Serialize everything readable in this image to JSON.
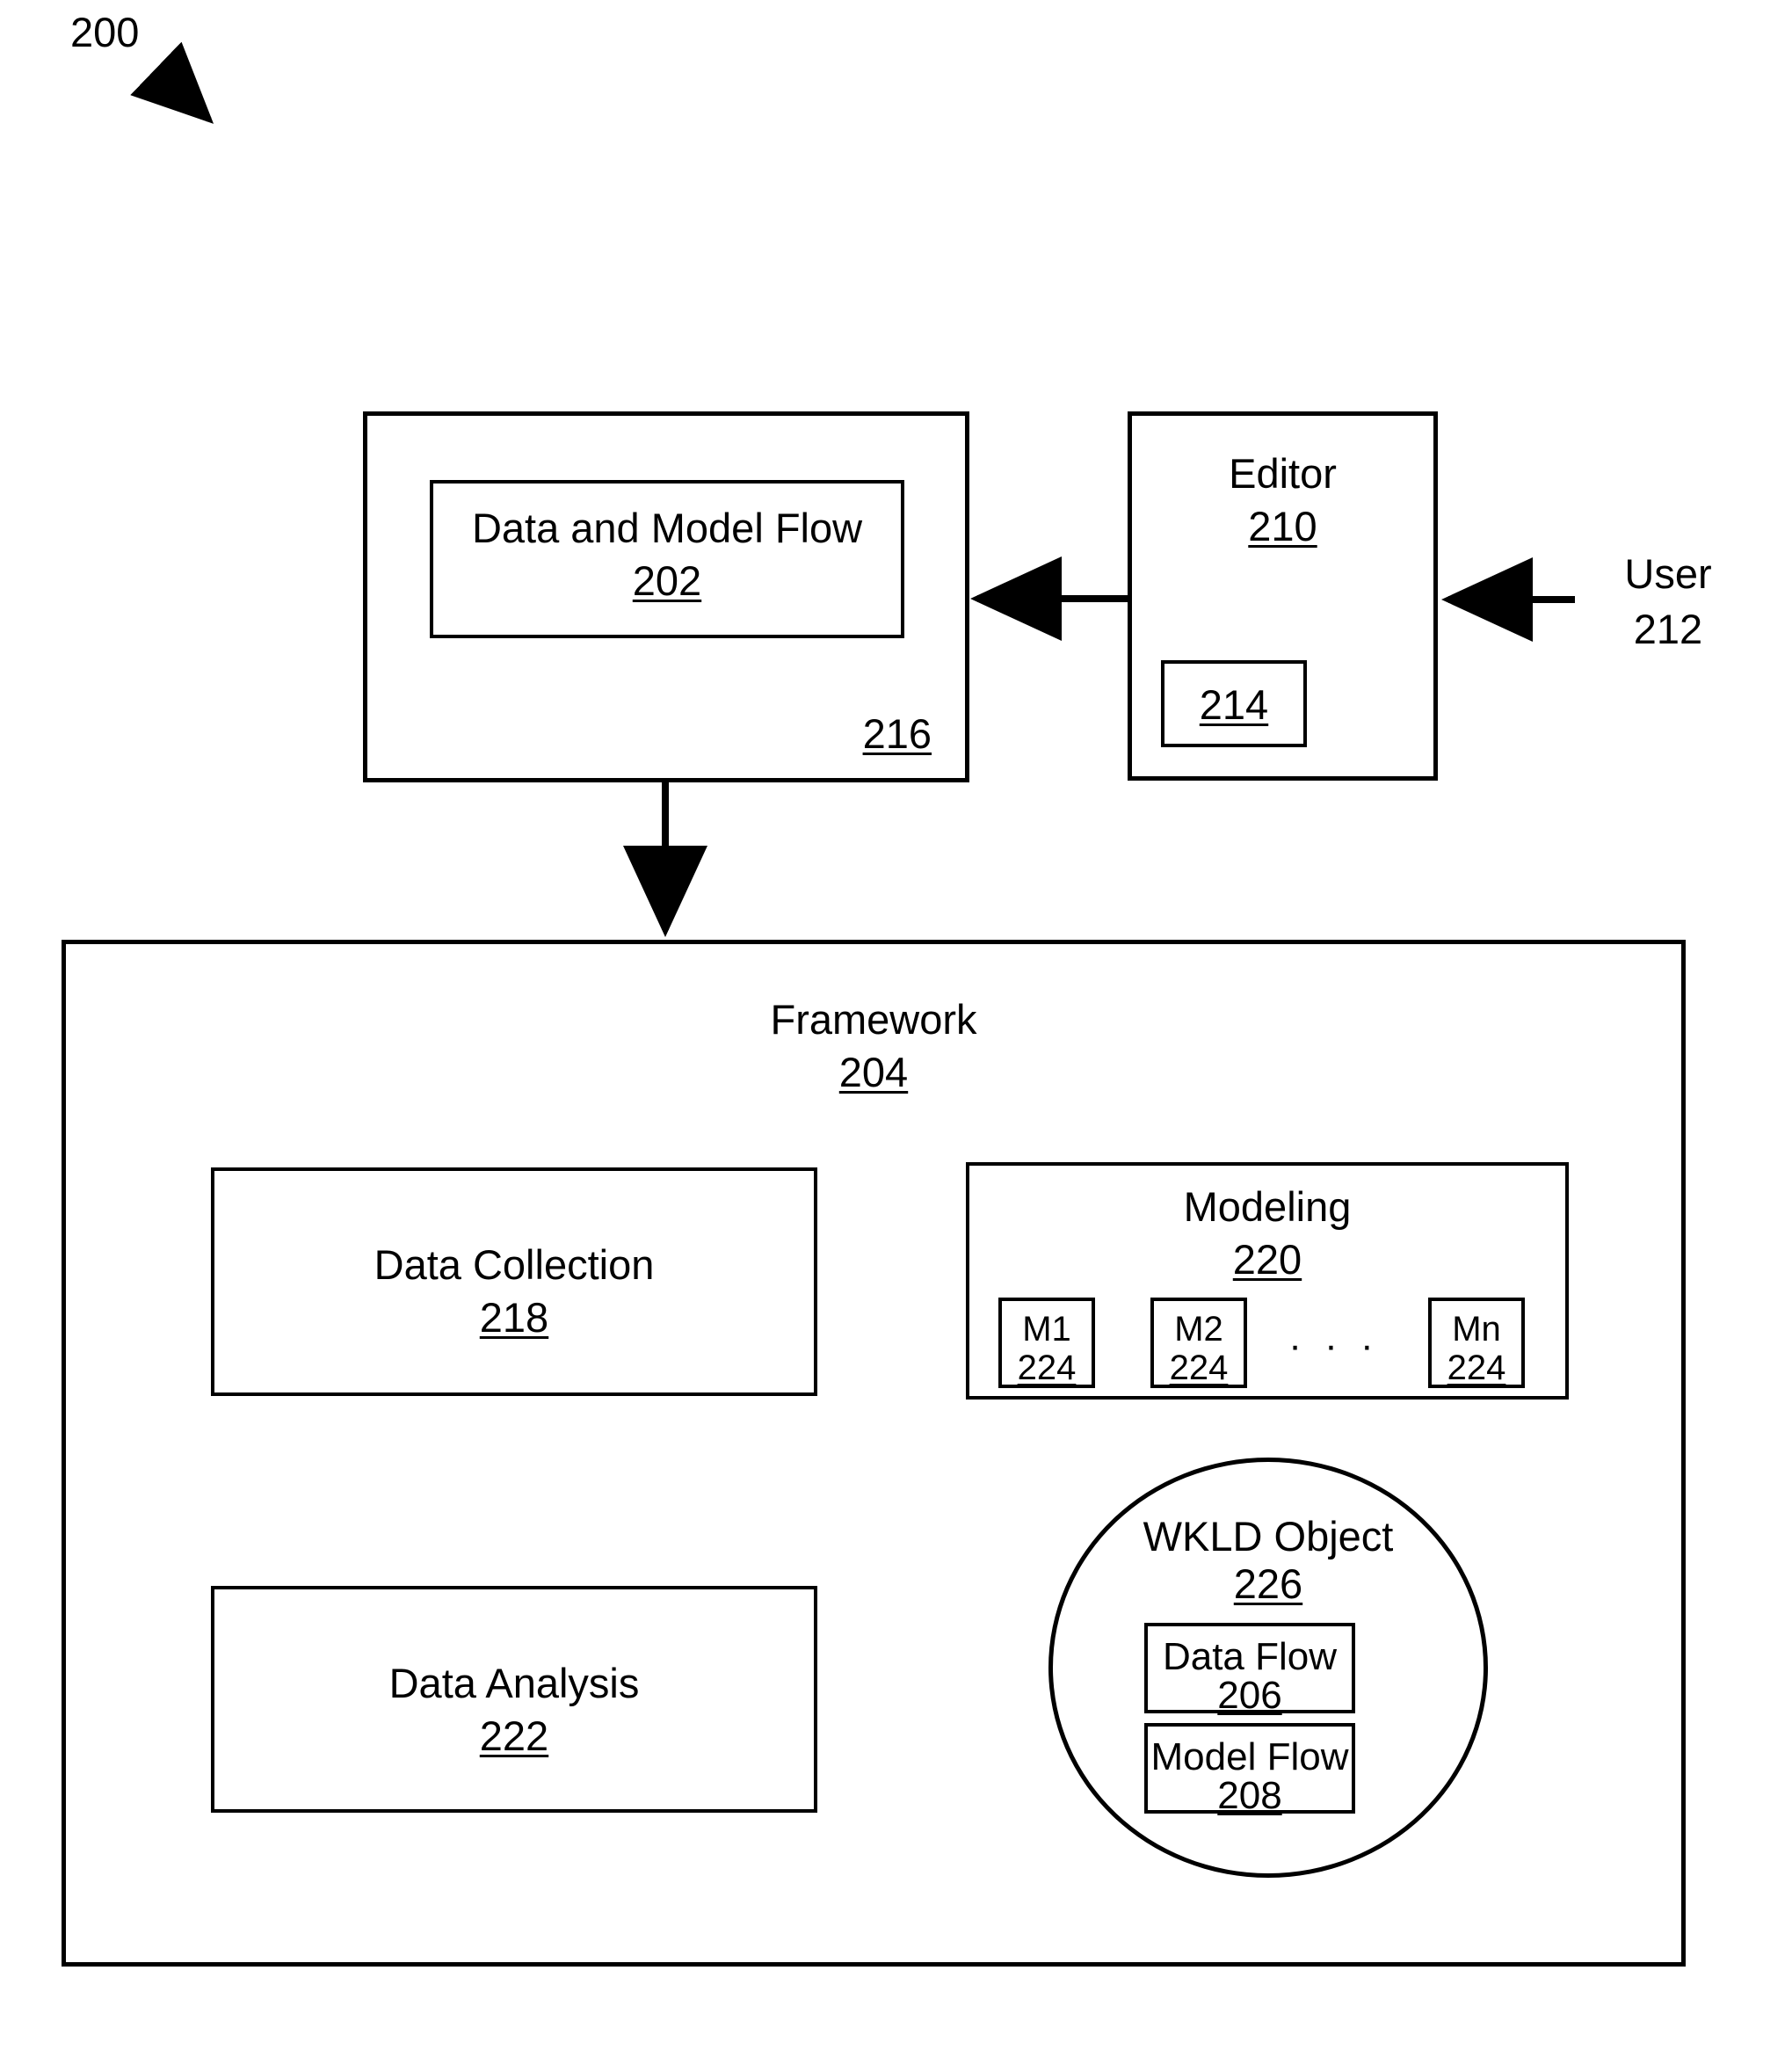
{
  "figure": {
    "number": "200",
    "pointer_icon": "diagonal-arrow-icon"
  },
  "top_section": {
    "flow_container": {
      "ref": "216",
      "inner_box": {
        "title": "Data and Model Flow",
        "ref": "202"
      }
    },
    "editor": {
      "title": "Editor",
      "ref": "210",
      "inner_box": {
        "ref": "214"
      }
    },
    "user": {
      "title": "User",
      "ref": "212"
    },
    "arrows": [
      {
        "name": "editor-to-flow-arrow",
        "direction": "left"
      },
      {
        "name": "user-to-editor-arrow",
        "direction": "left"
      },
      {
        "name": "flow-to-framework-arrow",
        "direction": "down"
      }
    ]
  },
  "framework": {
    "title": "Framework",
    "ref": "204",
    "data_collection": {
      "title": "Data Collection",
      "ref": "218"
    },
    "data_analysis": {
      "title": "Data Analysis",
      "ref": "222"
    },
    "modeling": {
      "title": "Modeling",
      "ref": "220",
      "ellipsis": "· · ·",
      "models": [
        {
          "label": "M1",
          "ref": "224"
        },
        {
          "label": "M2",
          "ref": "224"
        },
        {
          "label": "Mn",
          "ref": "224"
        }
      ]
    },
    "wkld_object": {
      "title": "WKLD Object",
      "ref": "226",
      "flows": [
        {
          "title": "Data Flow",
          "ref": "206"
        },
        {
          "title": "Model Flow",
          "ref": "208"
        }
      ]
    }
  },
  "colors": {
    "stroke": "#000000",
    "background": "#ffffff"
  }
}
